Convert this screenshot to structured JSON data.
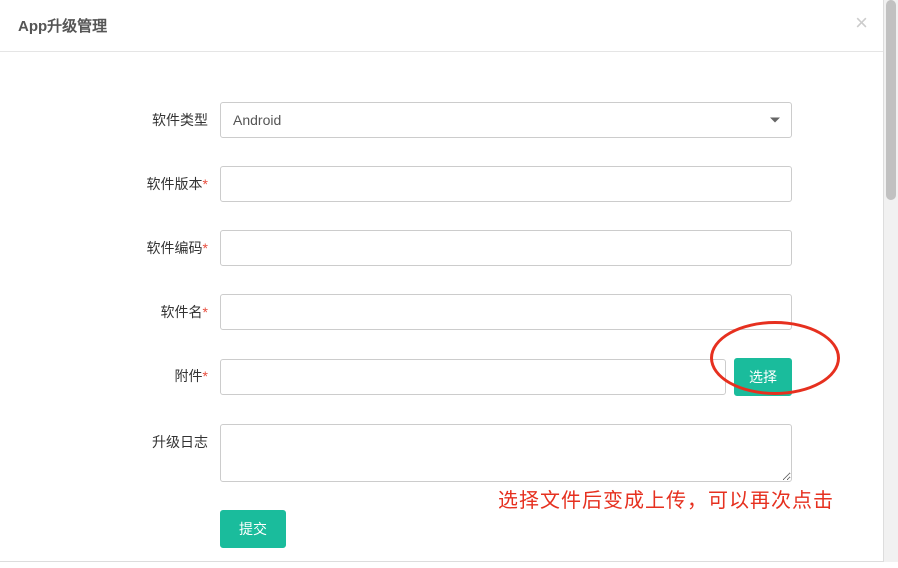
{
  "modal": {
    "title": "App升级管理",
    "close_icon": "×"
  },
  "form": {
    "software_type": {
      "label": "软件类型",
      "value": "Android"
    },
    "software_version": {
      "label": "软件版本",
      "required_mark": "*",
      "value": ""
    },
    "software_code": {
      "label": "软件编码",
      "required_mark": "*",
      "value": ""
    },
    "software_name": {
      "label": "软件名",
      "required_mark": "*",
      "value": ""
    },
    "attachment": {
      "label": "附件",
      "required_mark": "*",
      "value": "",
      "select_button": "选择"
    },
    "upgrade_log": {
      "label": "升级日志",
      "value": ""
    },
    "submit_button": "提交"
  },
  "annotation": {
    "text": "选择文件后变成上传，可以再次点击"
  }
}
